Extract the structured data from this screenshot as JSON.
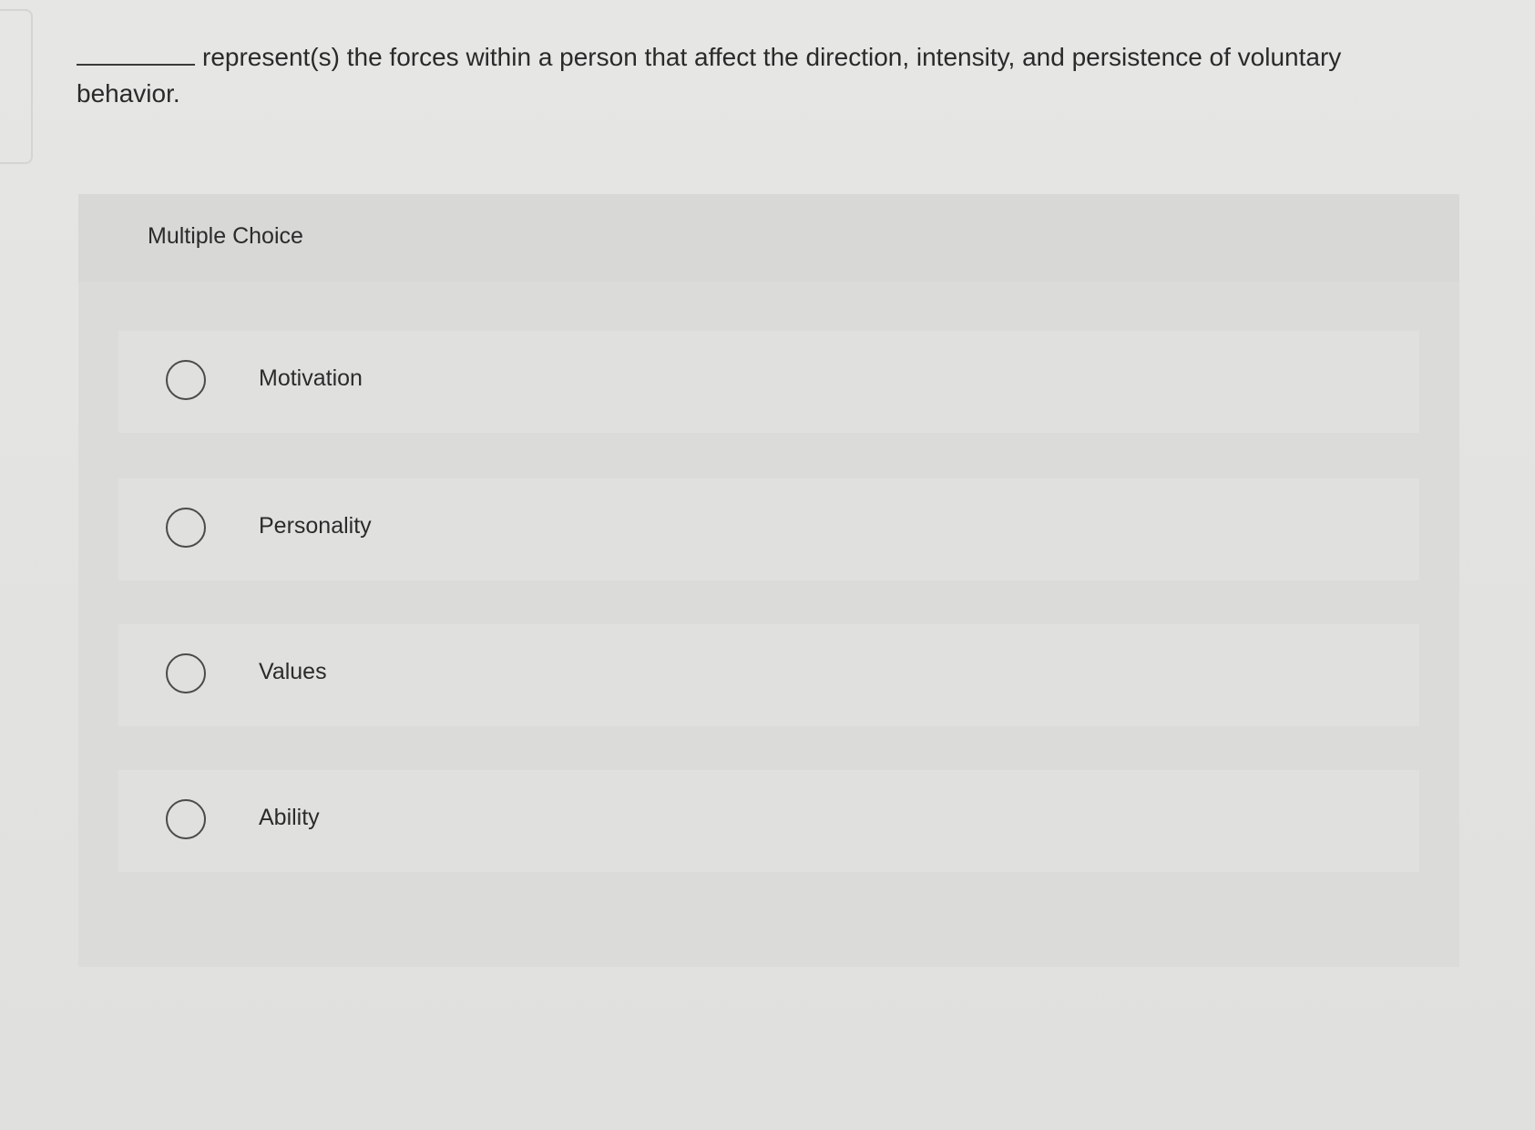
{
  "question": {
    "text": "represent(s) the forces within a person that affect the direction, intensity, and persistence of voluntary behavior."
  },
  "panel": {
    "title": "Multiple Choice",
    "options": [
      {
        "label": "Motivation"
      },
      {
        "label": "Personality"
      },
      {
        "label": "Values"
      },
      {
        "label": "Ability"
      }
    ]
  }
}
